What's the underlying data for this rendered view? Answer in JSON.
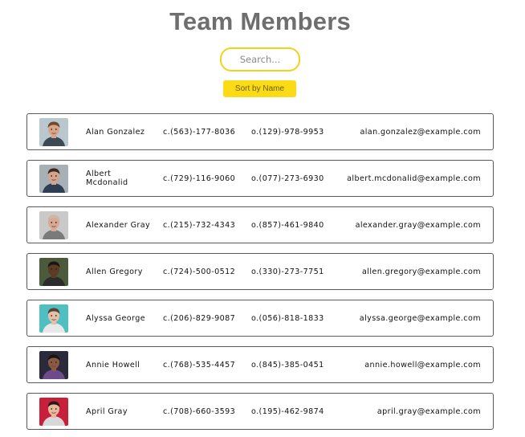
{
  "header": {
    "title": "Team Members"
  },
  "search": {
    "placeholder": "Search..."
  },
  "sort": {
    "label": "Sort by Name"
  },
  "members": [
    {
      "name": "Alan Gonzalez",
      "cell": "c.(563)-177-8036",
      "office": "o.(129)-978-9953",
      "email": "alan.gonzalez@example.com",
      "avatar": {
        "bg": "#b9c8cf",
        "skin": "#d9a58a",
        "hair": "#6b4a2f",
        "shirt": "#3d4a56"
      }
    },
    {
      "name": "Albert Mcdonalid",
      "cell": "c.(729)-116-9060",
      "office": "o.(077)-273-6930",
      "email": "albert.mcdonalid@example.com",
      "avatar": {
        "bg": "#a7b0b4",
        "skin": "#d4a48e",
        "hair": "#3a2a20",
        "shirt": "#2f3e52"
      }
    },
    {
      "name": "Alexander Gray",
      "cell": "c.(215)-732-4343",
      "office": "o.(857)-461-9840",
      "email": "alexander.gray@example.com",
      "avatar": {
        "bg": "#c9c9c9",
        "skin": "#d7a994",
        "hair": "#c9b8a8",
        "shirt": "#7a7a7a"
      }
    },
    {
      "name": "Allen Gregory",
      "cell": "c.(724)-500-0512",
      "office": "o.(330)-273-7751",
      "email": "allen.gregory@example.com",
      "avatar": {
        "bg": "#4a5a3a",
        "skin": "#5b3a26",
        "hair": "#1e1410",
        "shirt": "#2c2c2c"
      }
    },
    {
      "name": "Alyssa George",
      "cell": "c.(206)-829-9087",
      "office": "o.(056)-818-1833",
      "email": "alyssa.george@example.com",
      "avatar": {
        "bg": "#4fbfc2",
        "skin": "#e4c0aa",
        "hair": "#5a4030",
        "shirt": "#e8e8e8"
      }
    },
    {
      "name": "Annie Howell",
      "cell": "c.(768)-535-4457",
      "office": "o.(845)-385-0451",
      "email": "annie.howell@example.com",
      "avatar": {
        "bg": "#2a2a3a",
        "skin": "#8a5a44",
        "hair": "#1c1412",
        "shirt": "#6d4a8a"
      }
    },
    {
      "name": "April Gray",
      "cell": "c.(708)-660-3593",
      "office": "o.(195)-462-9874",
      "email": "april.gray@example.com",
      "avatar": {
        "bg": "#c8203a",
        "skin": "#e6b8a0",
        "hair": "#2a1a14",
        "shirt": "#d8d8d8"
      }
    }
  ]
}
